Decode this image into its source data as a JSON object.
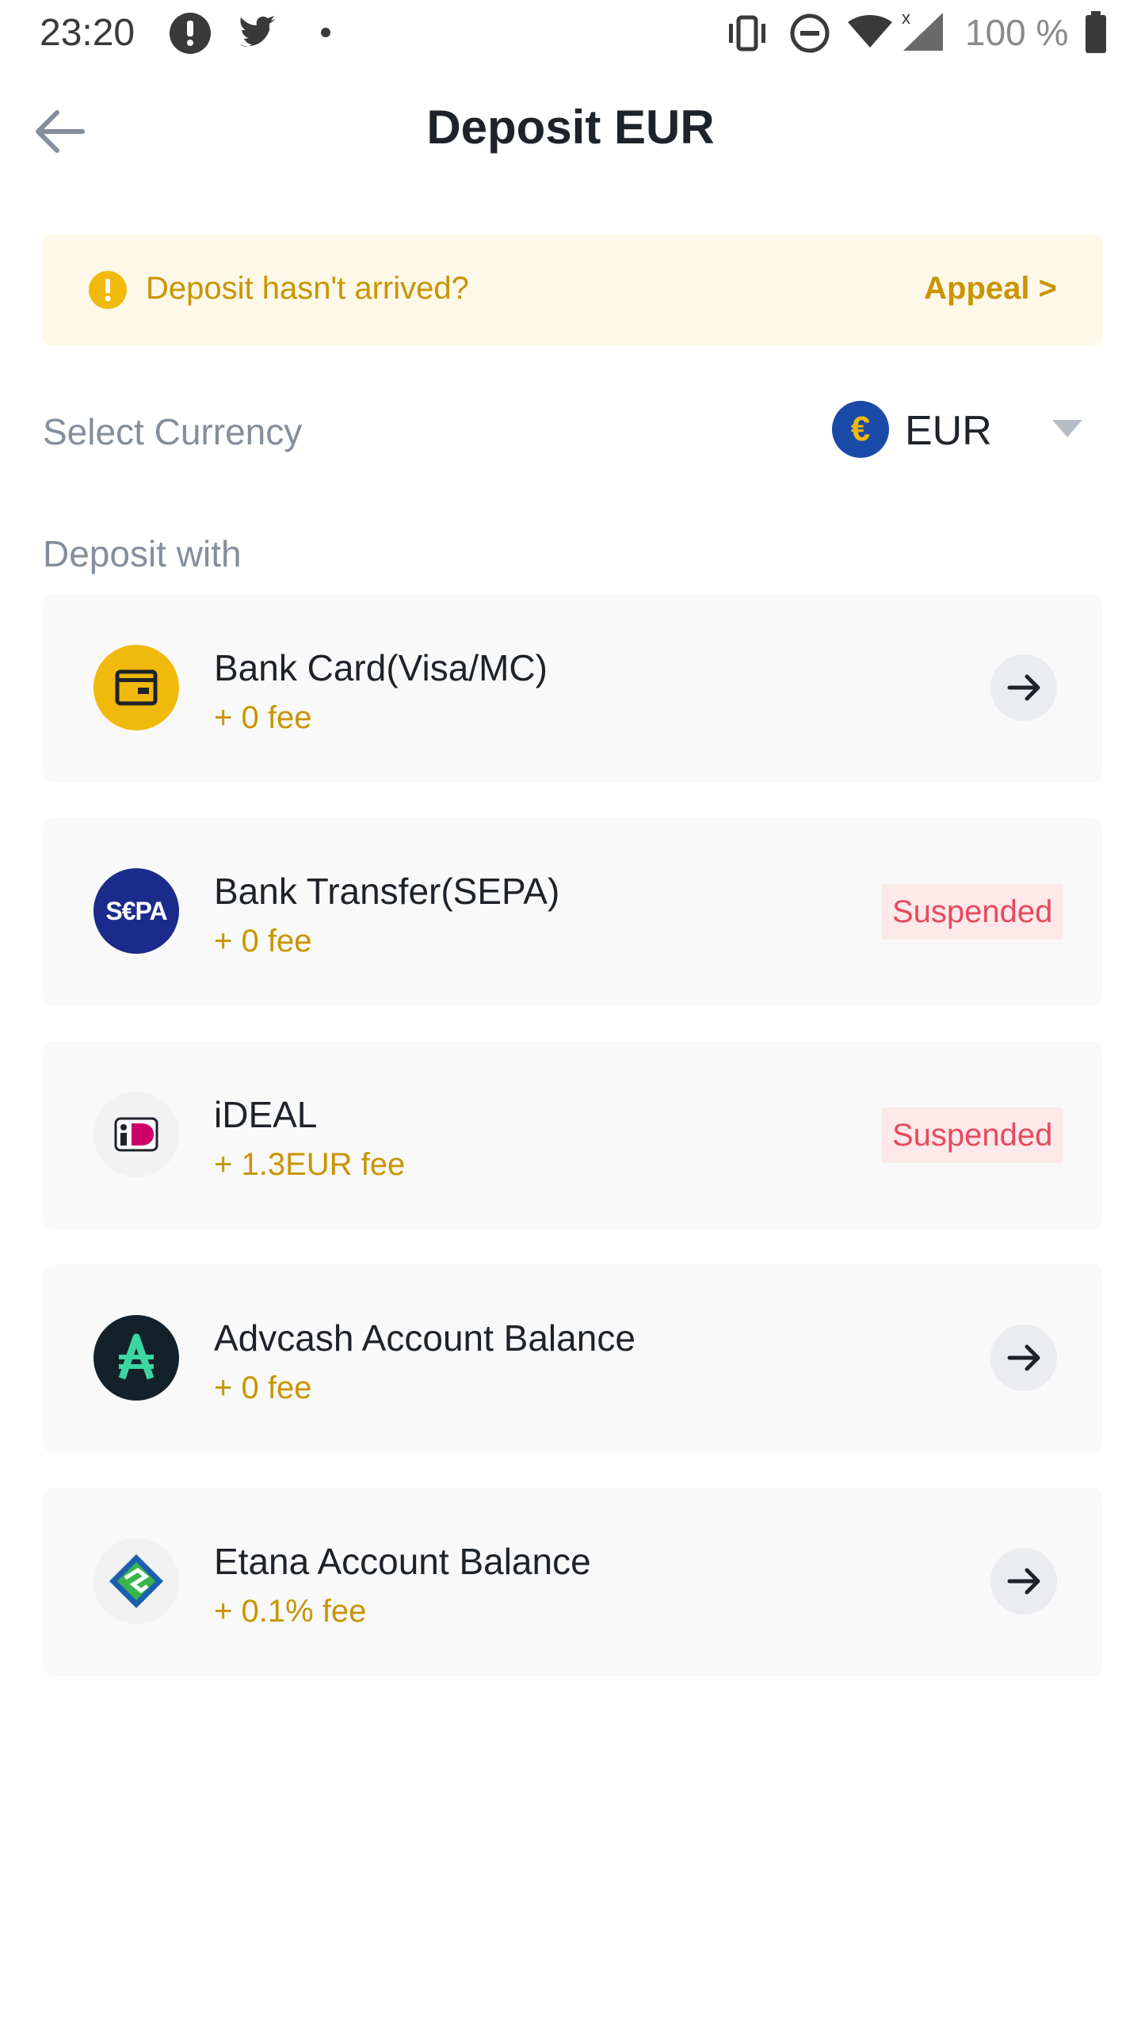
{
  "status_bar": {
    "time": "23:20",
    "icons": [
      "notification-icon",
      "twitter-icon",
      "dot-icon",
      "vibrate-icon",
      "dnd-icon",
      "wifi-icon",
      "signal-icon",
      "battery-icon"
    ],
    "battery": "100 %"
  },
  "header": {
    "title": "Deposit EUR",
    "back_icon": "arrow-left-icon"
  },
  "alert": {
    "text": "Deposit hasn't arrived?",
    "link": "Appeal >",
    "icon": "exclamation-icon"
  },
  "currency": {
    "label": "Select Currency",
    "code": "EUR",
    "symbol": "€",
    "icon": "euro-icon"
  },
  "deposit_with_label": "Deposit with",
  "methods": [
    {
      "name": "Bank Card(Visa/MC)",
      "fee": "+ 0 fee",
      "icon": "wallet-icon",
      "action": "arrow"
    },
    {
      "name": "Bank Transfer(SEPA)",
      "fee": "+ 0 fee",
      "icon": "sepa-icon",
      "status": "Suspended",
      "logo_text": "S€PA"
    },
    {
      "name": "iDEAL",
      "fee": "+ 1.3EUR fee",
      "icon": "ideal-icon",
      "status": "Suspended"
    },
    {
      "name": "Advcash Account Balance",
      "fee": "+ 0 fee",
      "icon": "advcash-icon",
      "action": "arrow"
    },
    {
      "name": "Etana Account Balance",
      "fee": "+ 0.1% fee",
      "icon": "etana-icon",
      "action": "arrow"
    }
  ],
  "colors": {
    "accent": "#c99400",
    "alert_bg": "#fdf8e8",
    "suspended_text": "#e64a5e",
    "suspended_bg": "#fde8ea",
    "card_bg": "#f9f9f9",
    "muted_text": "#848e9c"
  }
}
